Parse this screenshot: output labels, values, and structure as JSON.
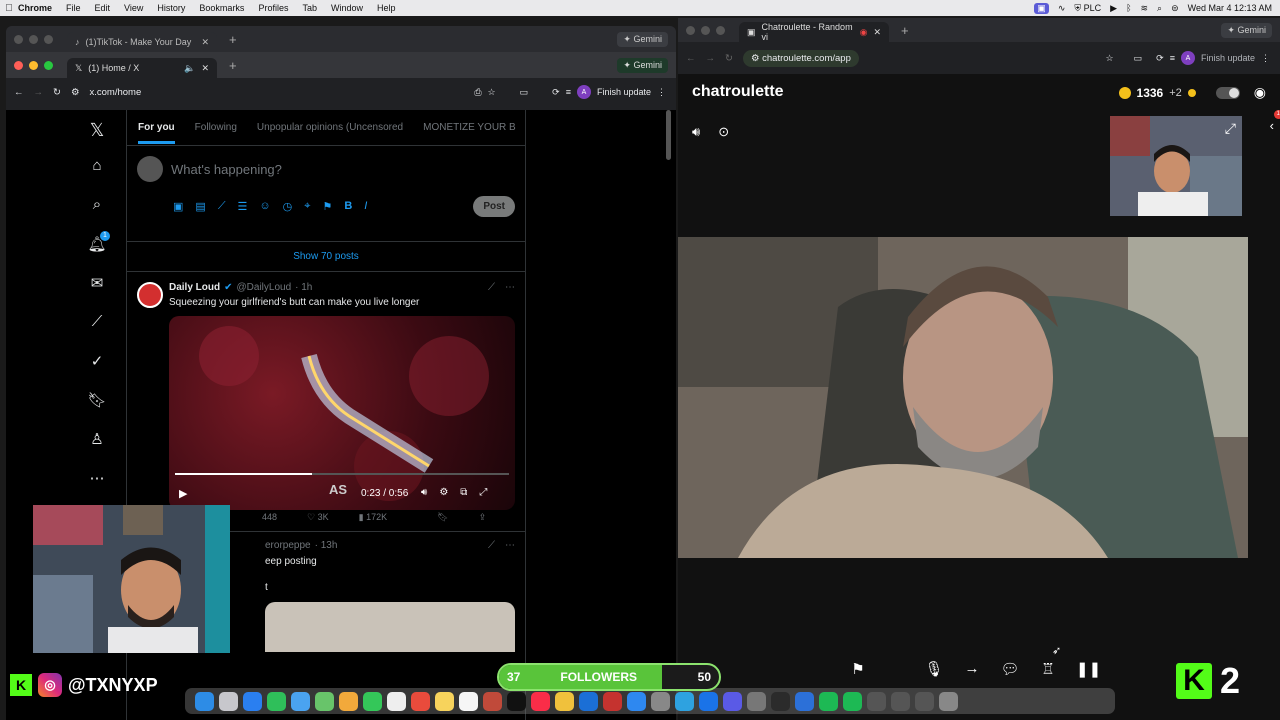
{
  "menubar": {
    "app": "Chrome",
    "items": [
      "File",
      "Edit",
      "View",
      "History",
      "Bookmarks",
      "Profiles",
      "Tab",
      "Window",
      "Help"
    ],
    "status_plc": "PLC",
    "clock": "Wed Mar 4  12:13 AM"
  },
  "left_window": {
    "outer_tab": "(1)TikTok - Make Your Day",
    "inner_tab": "(1) Home / X",
    "gemini": "Gemini",
    "url": "x.com/home",
    "finish_update": "Finish update",
    "avatar_letter": "A"
  },
  "x": {
    "tabs": [
      "For you",
      "Following",
      "Unpopular opinions (Uncensored",
      "MONETIZE YOUR B"
    ],
    "compose_placeholder": "What's happening?",
    "post_button": "Post",
    "show_posts": "Show 70 posts",
    "notification_count": "1",
    "tweet1": {
      "author": "Daily Loud",
      "handle": "@DailyLoud",
      "time": "· 1h",
      "text": "Squeezing your girlfriend's butt can make you live longer",
      "video_time": "0:23 / 0:56",
      "video_watermark": "AS",
      "video_progress": 0.41,
      "retweets": "448",
      "likes": "3K",
      "views": "172K"
    },
    "tweet2": {
      "handle_fragment": "erorpeppe",
      "time": "· 13h",
      "text": "eep posting",
      "text2": "t"
    }
  },
  "right_window": {
    "tab": "Chatroulette - Random vi",
    "url": "chatroulette.com/app",
    "finish_update": "Finish update",
    "gemini": "Gemini",
    "avatar_letter": "A"
  },
  "chatroulette": {
    "logo": "chatroulette",
    "coins": "1336",
    "bonus": "+2",
    "notification": "1"
  },
  "overlay": {
    "handle": "@TXNYXP",
    "followers_label": "FOLLOWERS",
    "followers_current": "37",
    "followers_goal": "50",
    "kick_count": "2"
  },
  "colors": {
    "x_blue": "#1d9bf0",
    "kick_green": "#53fc18",
    "follower_bar": "#59c43a",
    "coin_gold": "#f4c01b"
  }
}
